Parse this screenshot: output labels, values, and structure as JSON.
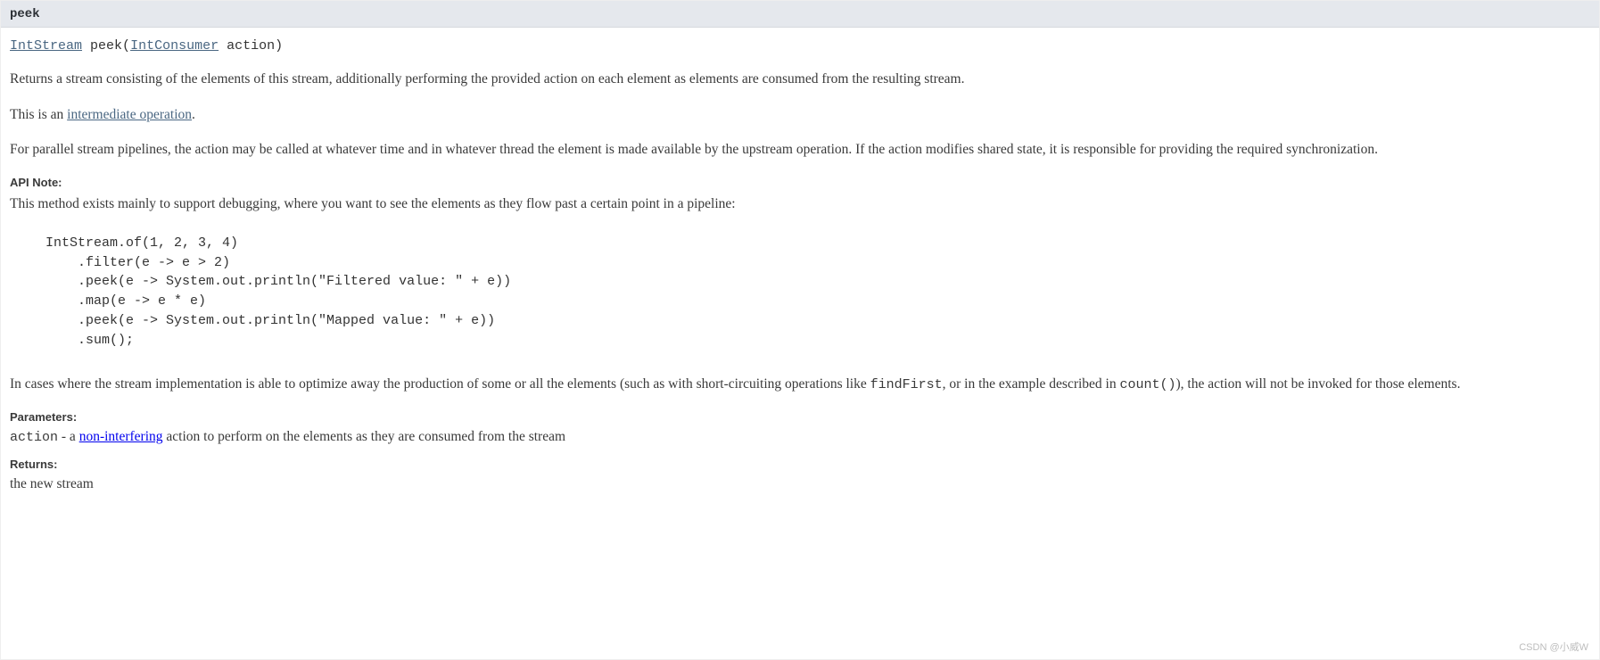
{
  "header": {
    "method_name": "peek"
  },
  "signature": {
    "return_type": "IntStream",
    "method": "peek",
    "param_type": "IntConsumer",
    "param_name": "action"
  },
  "desc": {
    "p1": "Returns a stream consisting of the elements of this stream, additionally performing the provided action on each element as elements are consumed from the resulting stream.",
    "p2_prefix": "This is an ",
    "p2_link": "intermediate operation",
    "p2_suffix": ".",
    "p3": "For parallel stream pipelines, the action may be called at whatever time and in whatever thread the element is made available by the upstream operation. If the action modifies shared state, it is responsible for providing the required synchronization."
  },
  "api_note": {
    "label": "API Note:",
    "intro": "This method exists mainly to support debugging, where you want to see the elements as they flow past a certain point in a pipeline:",
    "code": "IntStream.of(1, 2, 3, 4)\n    .filter(e -> e > 2)\n    .peek(e -> System.out.println(\"Filtered value: \" + e))\n    .map(e -> e * e)\n    .peek(e -> System.out.println(\"Mapped value: \" + e))\n    .sum();",
    "after_code_prefix": "In cases where the stream implementation is able to optimize away the production of some or all the elements (such as with short-circuiting operations like ",
    "code_ref1": "findFirst",
    "after_code_mid": ", or in the example described in ",
    "code_ref2": "count()",
    "after_code_suffix": "), the action will not be invoked for those elements."
  },
  "parameters": {
    "label": "Parameters:",
    "name": "action",
    "dash": " - a ",
    "link": "non-interfering",
    "rest": " action to perform on the elements as they are consumed from the stream"
  },
  "returns": {
    "label": "Returns:",
    "text": "the new stream"
  },
  "watermark": "CSDN @小威W"
}
